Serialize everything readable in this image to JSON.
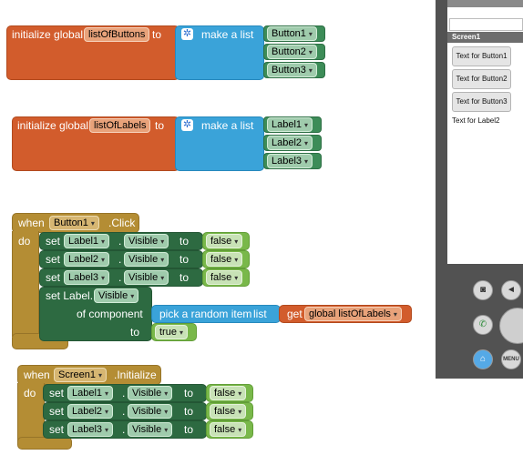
{
  "blocks": {
    "init_buttons": {
      "prefix": "initialize global",
      "var_name": "listOfButtons",
      "to": "to",
      "make_list": "make a list",
      "items": [
        "Button1",
        "Button2",
        "Button3"
      ]
    },
    "init_labels": {
      "prefix": "initialize global",
      "var_name": "listOfLabels",
      "to": "to",
      "make_list": "make a list",
      "items": [
        "Label1",
        "Label2",
        "Label3"
      ]
    },
    "button_click": {
      "when": "when",
      "component": "Button1",
      "event": ".Click",
      "do": "do",
      "sets": [
        {
          "set": "set",
          "component": "Label1",
          "dot": ".",
          "property": "Visible",
          "to": "to",
          "value": "false"
        },
        {
          "set": "set",
          "component": "Label2",
          "dot": ".",
          "property": "Visible",
          "to": "to",
          "value": "false"
        },
        {
          "set": "set",
          "component": "Label3",
          "dot": ".",
          "property": "Visible",
          "to": "to",
          "value": "false"
        }
      ],
      "generic_set": {
        "label": "set Label.",
        "property": "Visible",
        "of_component": "of component",
        "to": "to",
        "value": "true"
      },
      "pick_random": {
        "label": "pick a random item",
        "list": "list"
      },
      "get_global": {
        "label": "get",
        "var": "global listOfLabels"
      }
    },
    "screen_init": {
      "when": "when",
      "component": "Screen1",
      "event": ".Initialize",
      "do": "do",
      "sets": [
        {
          "set": "set",
          "component": "Label1",
          "dot": ".",
          "property": "Visible",
          "to": "to",
          "value": "false"
        },
        {
          "set": "set",
          "component": "Label2",
          "dot": ".",
          "property": "Visible",
          "to": "to",
          "value": "false"
        },
        {
          "set": "set",
          "component": "Label3",
          "dot": ".",
          "property": "Visible",
          "to": "to",
          "value": "false"
        }
      ]
    }
  },
  "emulator": {
    "screen_title": "Screen1",
    "buttons": [
      "Text for Button1",
      "Text for Button2",
      "Text for Button3"
    ],
    "label_text": "Text for Label2",
    "menu_label": "MENU",
    "icons": [
      "camera-icon",
      "volume-icon",
      "call-icon",
      "dpad-icon",
      "home-icon"
    ]
  },
  "colors": {
    "variable_orange": "#d25c2c",
    "list_blue": "#3aa3d9",
    "event_gold": "#b48d34",
    "setter_dark_green": "#2d6a41",
    "logic_light_green": "#79b84a",
    "component_green": "#3d8c58"
  }
}
